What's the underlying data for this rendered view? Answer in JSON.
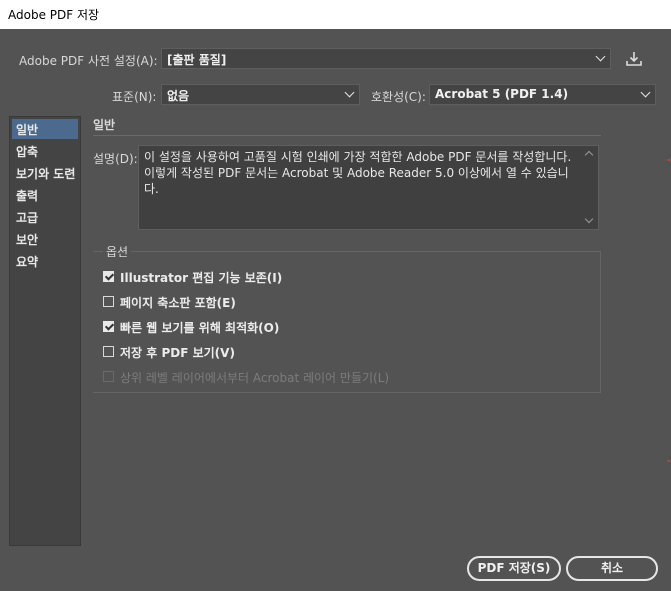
{
  "window": {
    "title": "Adobe PDF 저장"
  },
  "preset": {
    "label": "Adobe PDF 사전 설정(A):",
    "value": "[출판 품질]",
    "save_icon": "save-preset-icon"
  },
  "standard": {
    "label": "표준(N):",
    "value": "없음"
  },
  "compatibility": {
    "label": "호환성(C):",
    "value": "Acrobat 5 (PDF 1.4)"
  },
  "sidebar": {
    "items": [
      {
        "label": "일반",
        "active": true
      },
      {
        "label": "압축"
      },
      {
        "label": "보기와 도련"
      },
      {
        "label": "출력"
      },
      {
        "label": "고급"
      },
      {
        "label": "보안"
      },
      {
        "label": "요약"
      }
    ]
  },
  "general": {
    "title": "일반",
    "description_label": "설명(D):",
    "description": "이 설정을 사용하여 고품질 시험 인쇄에 가장 적합한 Adobe PDF 문서를 작성합니다. 이렇게 작성된 PDF 문서는 Acrobat 및 Adobe Reader 5.0 이상에서 열 수 있습니다."
  },
  "options": {
    "title": "옵션",
    "items": [
      {
        "label": "Illustrator 편집 기능 보존(I)",
        "checked": true,
        "enabled": true
      },
      {
        "label": "페이지 축소판 포함(E)",
        "checked": false,
        "enabled": true
      },
      {
        "label": "빠른 웹 보기를 위해 최적화(O)",
        "checked": true,
        "enabled": true
      },
      {
        "label": "저장 후 PDF 보기(V)",
        "checked": false,
        "enabled": true
      },
      {
        "label": "상위 레벨 레이어에서부터 Acrobat 레이어 만들기(L)",
        "checked": false,
        "enabled": false
      }
    ]
  },
  "buttons": {
    "save": "PDF 저장(S)",
    "cancel": "취소"
  }
}
